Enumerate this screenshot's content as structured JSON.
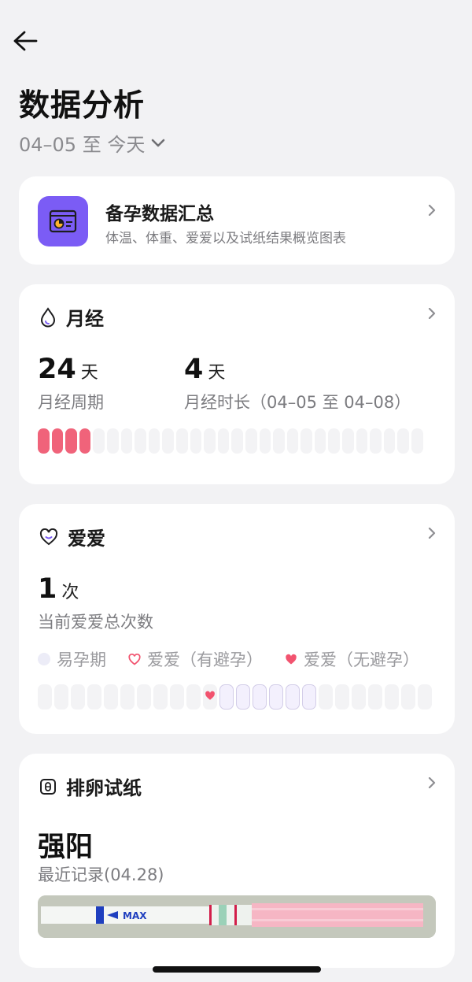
{
  "header": {
    "back_icon": "arrow-left-icon",
    "title": "数据分析",
    "range": "04–05 至 今天"
  },
  "summary": {
    "icon": "chart-card-icon",
    "title": "备孕数据汇总",
    "subtitle": "体温、体重、爱爱以及试纸结果概览图表"
  },
  "period": {
    "icon": "drop-icon",
    "title": "月经",
    "cycle": {
      "value": "24",
      "unit": "天",
      "label": "月经周期"
    },
    "duration": {
      "value": "4",
      "unit": "天",
      "label": "月经时长（04–05 至 04–08）"
    },
    "bar": {
      "total_days": 28,
      "highlighted_days": 4,
      "color": "#f0637a"
    }
  },
  "love": {
    "icon": "heart-icon",
    "title": "爱爱",
    "count": {
      "value": "1",
      "unit": "次",
      "label": "当前爱爱总次数"
    },
    "legend": [
      {
        "label": "易孕期",
        "marker": "light-dot"
      },
      {
        "label": "爱爱（有避孕）",
        "marker": "outline-heart"
      },
      {
        "label": "爱爱（无避孕）",
        "marker": "filled-heart"
      }
    ],
    "timeline": {
      "total_days": 24,
      "fertile_start": 11,
      "fertile_end": 16,
      "love_day": 10
    }
  },
  "ovulation": {
    "icon": "test-strip-icon",
    "title": "排卵试纸",
    "result": "强阳",
    "recent": "最近记录(04.28)",
    "strip_label": "MAX"
  },
  "colors": {
    "accent_purple": "#7b5cf5",
    "period_red": "#f0637a",
    "heart_pink": "#f2536f"
  }
}
